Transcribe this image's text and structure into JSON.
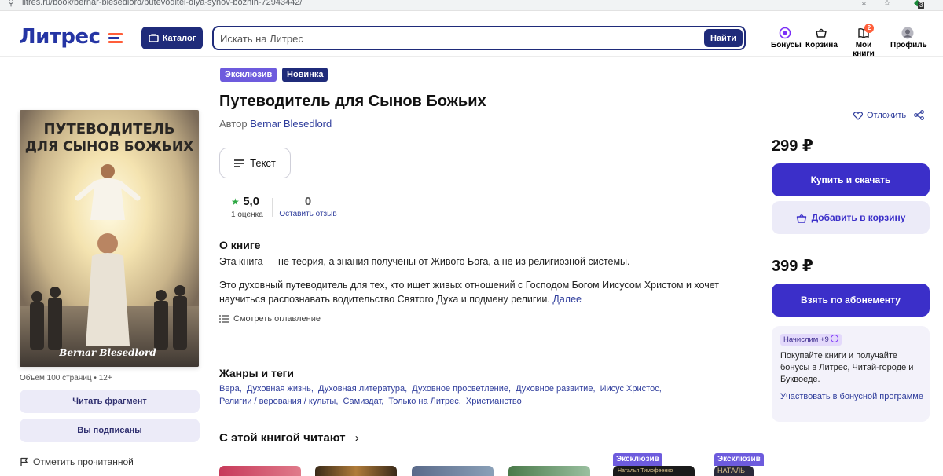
{
  "browser": {
    "url": "litres.ru/book/bernar-blesedlord/putevoditel-dlya-synov-bozhih-72943442/",
    "ext_count": "3"
  },
  "header": {
    "logo": "Литрес",
    "catalog_label": "Каталог",
    "search_placeholder": "Искать на Литрес",
    "search_button": "Найти",
    "nav": [
      {
        "label": "Бонусы",
        "icon": "bonus-icon"
      },
      {
        "label": "Корзина",
        "icon": "cart-icon"
      },
      {
        "label": "Мои книги",
        "icon": "books-icon",
        "badge": "2"
      },
      {
        "label": "Профиль",
        "icon": "avatar"
      }
    ]
  },
  "book": {
    "tags": [
      "Эксклюзив",
      "Новинка"
    ],
    "title": "Путеводитель для Сынов Божьих",
    "author_prefix": "Автор",
    "author": "Bernar Blesedlord",
    "format": "Текст",
    "rating_value": "5,0",
    "rating_count": "1 оценка",
    "reviews_count": "0",
    "reviews_label": "Оставить отзыв",
    "about_heading": "О книге",
    "about_p1": "Эта книга — не теория, а знания получены от Живого Бога, а не из религиозной системы.",
    "about_p2": "Это духовный путеводитель для тех, кто ищет живых отношений с Господом Богом Иисусом Христом и хочет научиться распознавать водительство Святого Духа и подмену религии.",
    "more_link": "Далее",
    "toc_label": "Смотреть оглавление",
    "genres_heading": "Жанры и теги",
    "genres": [
      "Вера,",
      "Духовная жизнь,",
      "Духовная литература,",
      "Духовное просветление,",
      "Духовное развитие,",
      "Иисус Христос,",
      "Религии / верования / культы,",
      "Самиздат,",
      "Только на Литрес,",
      "Христианство"
    ],
    "also_heading": "С этой книгой читают"
  },
  "cover": {
    "title_line1": "ПУТЕВОДИТЕЛЬ",
    "title_line2": "ДЛЯ СЫНОВ БОЖЬИХ",
    "author": "Bernar Blesedlord"
  },
  "left": {
    "meta": "Объем 100 страниц",
    "age": "12+",
    "read_fragment": "Читать фрагмент",
    "subscribed": "Вы подписаны",
    "mark_read": "Отметить прочитанной"
  },
  "purchase": {
    "postpone": "Отложить",
    "price1": "299 ₽",
    "buy_label": "Купить и скачать",
    "cart_label": "Добавить в корзину",
    "price2": "399 ₽",
    "subscription_label": "Взять по абонементу",
    "bonus_chip": "Начислим +9",
    "bonus_text": "Покупайте книги и получайте бонусы в Литрес, Читай-городе и Буквоеде.",
    "bonus_link": "Участвовать в бонусной программе"
  },
  "related": {
    "tags": [
      "Эксклюзив",
      "Эксклюзив"
    ],
    "thumb4_text": "Наталья Тимофеенко",
    "thumb5_text": "НАТАЛЬ"
  },
  "colors": {
    "brand": "#1f2b7a",
    "accent": "#3b2fc9",
    "link": "#2f3d9c",
    "exclusive": "#6d5bdd",
    "new": "#1f2b7a"
  }
}
